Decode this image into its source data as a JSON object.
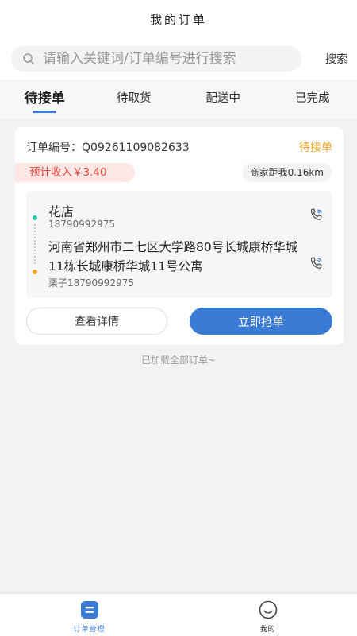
{
  "header": {
    "title": "我的订单"
  },
  "search": {
    "placeholder": "请输入关键词/订单编号进行搜索",
    "button_label": "搜索"
  },
  "tabs": [
    {
      "label": "待接单",
      "active": true
    },
    {
      "label": "待取货",
      "active": false
    },
    {
      "label": "配送中",
      "active": false
    },
    {
      "label": "已完成",
      "active": false
    }
  ],
  "order": {
    "number": "订单编号：Q09261109082633",
    "status": "待接单",
    "income": "预计收入￥3.40",
    "distance": "商家距我0.16km",
    "shop": {
      "name": "花店",
      "phone": "18790992975"
    },
    "delivery": {
      "address": "河南省郑州市二七区大学路80号长城康桥华城11栋长城康桥华城11号公寓",
      "contact": "栗子18790992975"
    },
    "detail_button": "查看详情",
    "grab_button": "立即抢单"
  },
  "footer_note": "已加载全部订单~",
  "bottom_nav": [
    {
      "label": "订单管理",
      "icon": "order-management-icon",
      "active": true
    },
    {
      "label": "我的",
      "icon": "profile-icon",
      "active": false
    }
  ],
  "colors": {
    "accent": "#3a7bd5",
    "pending": "#f4a21f",
    "income": "#e8433a",
    "shop_dot": "#2bc6a3"
  }
}
